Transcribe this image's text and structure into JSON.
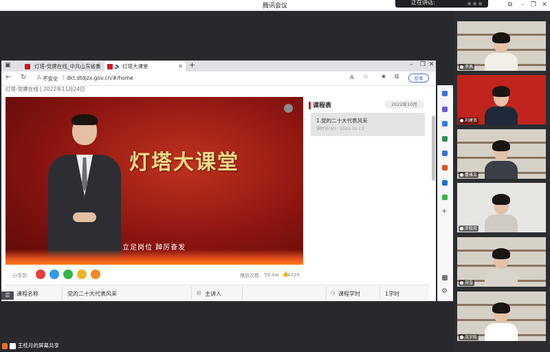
{
  "meeting": {
    "title": "腾讯会议",
    "speaking_label": "正在讲话:",
    "sharer_status": "王桂月的屏幕共享"
  },
  "browser": {
    "tabs": [
      {
        "label": "灯塔-党建在线_中共山东省委组"
      },
      {
        "label": "灯塔大课堂"
      }
    ],
    "security_label": "不安全",
    "url": "dkt.dtdjzx.gov.cn/#/home",
    "login_label": "登录",
    "breadcrumb": "灯塔-党建在线 | 2022年11月24日"
  },
  "video": {
    "title": "灯塔大课堂",
    "subtitle": "立足岗位  踔厉奋发"
  },
  "stats": {
    "share_label": "分享到:",
    "view_label": "播放次数:",
    "view_count": "59.4w",
    "like_count": "4329"
  },
  "course_panel": {
    "heading": "课程表",
    "date_filter": "2022年10月",
    "items": [
      {
        "title": "1.党的二十大代表风采",
        "sub": "课时长(分) · 2022-10-13"
      }
    ]
  },
  "info_row": {
    "course_name_label": "课程名称",
    "course_name_value": "党的二十大代表风采",
    "speaker_label": "主讲人",
    "hours_label": "课程学时",
    "hours_value": "1学时"
  },
  "participants": [
    {
      "name": "李茜",
      "shirt": "#f2efe8"
    },
    {
      "name": "刘建宽",
      "shirt": "#1e2a3a"
    },
    {
      "name": "曹雅文",
      "shirt": "#3b3f47"
    },
    {
      "name": "王桂月",
      "shirt": "#cfcbc4"
    },
    {
      "name": "郑雪",
      "shirt": "#d9d4cc"
    },
    {
      "name": "沈宇航",
      "shirt": "#ffffff"
    }
  ],
  "colors": {
    "accent_red": "#c8171e",
    "video_gold": "#f7d98b",
    "link_blue": "#3a6fd8"
  }
}
